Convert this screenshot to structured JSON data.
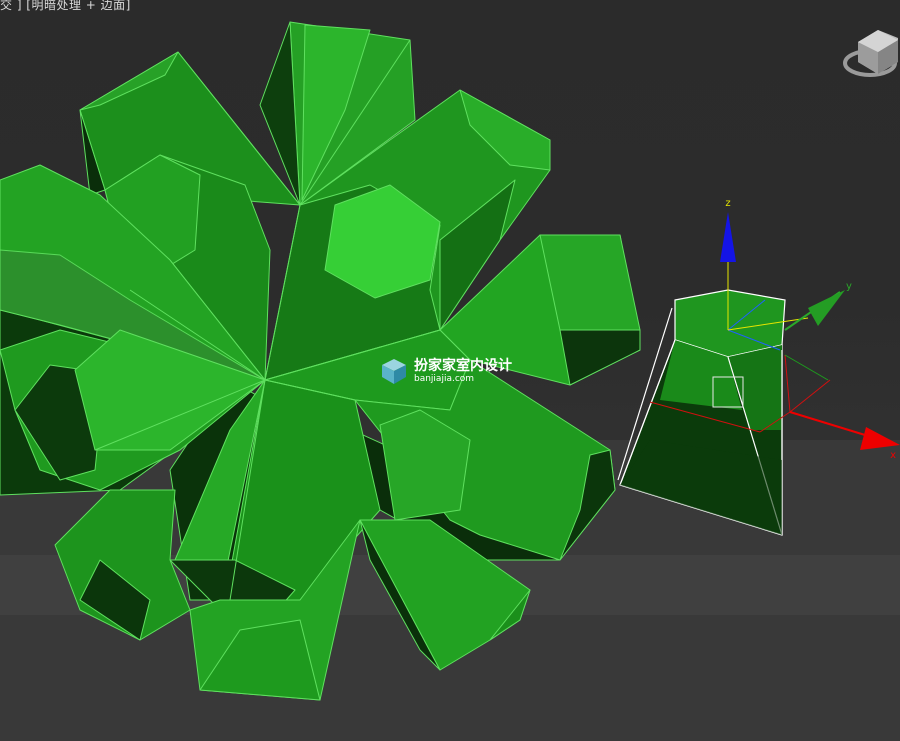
{
  "viewport": {
    "label": "交 ] [明暗处理 + 边面]",
    "colors": {
      "background": "#2c2c2c",
      "mesh": "#23a823",
      "mesh_dark": "#0b3f0b",
      "wire": "#5fe05f",
      "selection": "#ffffff"
    }
  },
  "gizmo": {
    "axes": [
      {
        "name": "z",
        "label": "z",
        "color": "#1414e6"
      },
      {
        "name": "y",
        "label": "y",
        "color": "#2aa82a"
      },
      {
        "name": "x",
        "label": "x",
        "color": "#ee0000"
      }
    ]
  },
  "viewcube": {
    "icon": "viewcube-icon"
  },
  "watermark": {
    "title": "扮家家室内设计",
    "url": "banjiajia.com",
    "icon": "banjiajia-logo-icon"
  }
}
